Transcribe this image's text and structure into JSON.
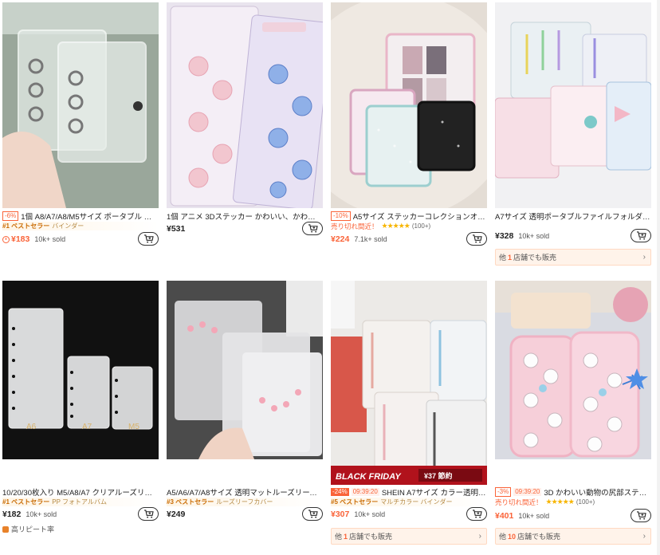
{
  "products": [
    {
      "title": "1個 A8/A7/A8/M5サイズ ポータブル トラ...",
      "discount": "-6%",
      "badge_rank": "#1 ベストセラー",
      "badge_category": "バインダー",
      "price": "¥183",
      "sold": "10k+ sold",
      "cart_label": "Add to cart",
      "has_clock": true
    },
    {
      "title": "1個 アニメ 3Dステッカー かわいい、かわいい...",
      "price": "¥531",
      "cart_label": "Add to cart"
    },
    {
      "title": "A5サイズ ステッカーコレクションオー...",
      "discount": "-10%",
      "soldout_label": "売り切れ間近！",
      "stars": "★★★★★",
      "rating_count": "(100+)",
      "price": "¥224",
      "sold": "7.1k+ sold",
      "cart_label": "Add to cart"
    },
    {
      "title": "A7サイズ 透明ポータブルファイルフォルダー...",
      "price": "¥328",
      "sold": "10k+ sold",
      "cart_label": "Add to cart",
      "store_prefix": "他",
      "store_count": "1",
      "store_suffix": "店舗でも販売"
    },
    {
      "title": "10/20/30枚入り M5/A8/A7 クリアルーズリーフ...",
      "badge_rank": "#1 ベストセラー",
      "badge_category": "PP フォトアルバム",
      "price": "¥182",
      "sold": "10k+ sold",
      "cart_label": "Add to cart",
      "repeat_label": "高リピート率"
    },
    {
      "title": "A5/A6/A7/A8サイズ 透明マットルーズリーフバ...",
      "badge_rank": "#3 ベストセラー",
      "badge_category": "ルーズリーフカバー",
      "price": "¥249",
      "cart_label": "Add to cart"
    },
    {
      "title": "SHEIN A7サイズ カラー透明ポー...",
      "discount": "-24%",
      "deal_time": "09:39:20",
      "badge_rank": "#5 ベストセラー",
      "badge_category": "マルチカラー バインダー",
      "price": "¥307",
      "sold": "10k+ sold",
      "cart_label": "Add to cart",
      "store_prefix": "他",
      "store_count": "1",
      "store_suffix": "店舗でも販売",
      "banner_text": "BLACK FRIDAY",
      "banner_price": "¥37 節約"
    },
    {
      "title": "3D かわいい動物の尻部ステッカ...",
      "discount": "-3%",
      "deal_time": "09:39:20",
      "soldout_label": "売り切れ間近！",
      "stars": "★★★★★",
      "rating_count": "(100+)",
      "price": "¥401",
      "sold": "10k+ sold",
      "cart_label": "Add to cart",
      "store_prefix": "他",
      "store_count": "10",
      "store_suffix": "店舗でも販売"
    }
  ],
  "images": {
    "p1_label_a6": "A6",
    "p1_label_a7": "A7",
    "p1_label_m5": "M5"
  },
  "colors": {
    "accent": "#fa6338",
    "star": "#f7b500",
    "badge_bg": "#fff5e6",
    "store_bg": "#fff3ea"
  }
}
